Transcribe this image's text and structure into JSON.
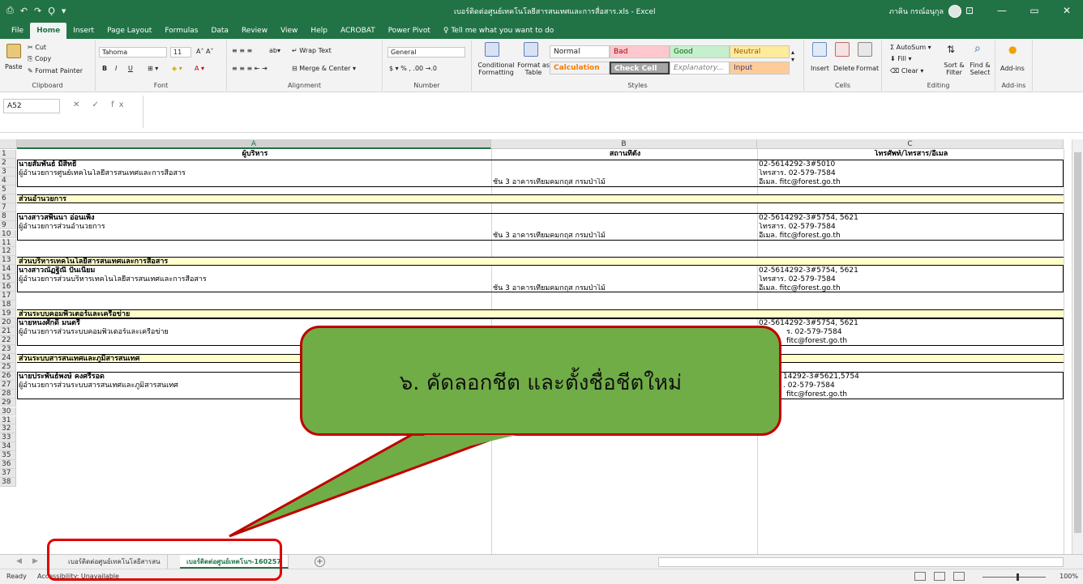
{
  "window": {
    "title": "เบอร์ติดต่อศูนย์เทคโนโลยีสารสนเทศและการสื่อสาร.xls  -  Excel",
    "user": "ภาคิน กรณ์อนุกุล",
    "qat": [
      "⎙",
      "↶",
      "↷",
      "Ǫ",
      "▾"
    ],
    "controls": [
      "⊡",
      "—",
      "▭",
      "✕"
    ]
  },
  "ribbon_tabs": [
    "File",
    "Home",
    "Insert",
    "Page Layout",
    "Formulas",
    "Data",
    "Review",
    "View",
    "Help",
    "ACROBAT",
    "Power Pivot"
  ],
  "tell_me": "Tell me what you want to do",
  "ribbon": {
    "clipboard": {
      "label": "Clipboard",
      "paste": "Paste",
      "cut": "Cut",
      "copy": "Copy",
      "format_painter": "Format Painter"
    },
    "font": {
      "label": "Font",
      "name": "Tahoma",
      "size": "11",
      "bold": "B",
      "italic": "I",
      "underline": "U"
    },
    "alignment": {
      "label": "Alignment",
      "wrap": "Wrap Text",
      "merge": "Merge & Center"
    },
    "number": {
      "label": "Number",
      "format": "General"
    },
    "styles": {
      "label": "Styles",
      "cond": "Conditional Formatting",
      "table": "Format as Table",
      "normal": "Normal",
      "bad": "Bad",
      "good": "Good",
      "neutral": "Neutral",
      "calculation": "Calculation",
      "check_cell": "Check Cell",
      "explanatory": "Explanatory...",
      "input": "Input"
    },
    "cells": {
      "label": "Cells",
      "insert": "Insert",
      "delete": "Delete",
      "format": "Format"
    },
    "editing": {
      "label": "Editing",
      "autosum": "AutoSum",
      "fill": "Fill",
      "clear": "Clear",
      "sort": "Sort & Filter",
      "find": "Find & Select"
    },
    "addins": {
      "label": "Add-ins",
      "btn": "Add-ins"
    }
  },
  "formula_bar": {
    "name_box": "A52",
    "fx": "✕  ✓  fx",
    "value": ""
  },
  "columns": [
    "A",
    "B",
    "C"
  ],
  "rows": [
    "1",
    "2",
    "3",
    "4",
    "5",
    "6",
    "7",
    "8",
    "9",
    "10",
    "11",
    "12",
    "13",
    "14",
    "15",
    "16",
    "17",
    "18",
    "19",
    "20",
    "21",
    "22",
    "23",
    "24",
    "25",
    "26",
    "27",
    "28",
    "29",
    "30",
    "31",
    "32",
    "33",
    "34",
    "35",
    "36",
    "37",
    "38"
  ],
  "sheet": {
    "headers": {
      "a": "ผู้บริหาร",
      "b": "สถานที่ตั้ง",
      "c": "โทรศัพท์/โทรสาร/อีเมล"
    },
    "r2a": "นายสัมพันธ์ มีสิทธิ์",
    "r3a": "ผู้อำนวยการศูนย์เทคโนโลยีสารสนเทศและการสื่อสาร",
    "r2c": "02-5614292-3#5010",
    "r3c": "โทรสาร. 02-579-7584",
    "r4c": "อีเมล. fitc@forest.go.th",
    "r4b": "ชั้น 3 อาคารเทียมคมกฤส กรมป่าไม้",
    "r6": "ส่วนอำนวยการ",
    "r7a": "นางสาวสพินนา อ่อนเพ็ง",
    "r8a": "ผู้อำนวยการส่วนอำนวยการ",
    "r7c": "02-5614292-3#5754, 5621",
    "r8c": "โทรสาร. 02-579-7584",
    "r9c": "อีเมล. fitc@forest.go.th",
    "r9b": "ชั้น 3 อาคารเทียมคมกฤส กรมป่าไม้",
    "r11": "ส่วนบริหารเทคโนโลยีสารสนเทศและการสื่อสาร",
    "r12a": "นางสาวณัฏฐิณี ปั้นเนียม",
    "r13a": "ผู้อำนวยการส่วนบริหารเทคโนโลยีสารสนเทศและการสื่อสาร",
    "r12c": "02-5614292-3#5754, 5621",
    "r13c": "โทรสาร. 02-579-7584",
    "r14c": "อีเมล. fitc@forest.go.th",
    "r14b": "ชั้น 3 อาคารเทียมคมกฤส กรมป่าไม้",
    "r16": "ส่วนระบบคอมพิวเตอร์และเครือข่าย",
    "r17a": "นายหนงศักดิ์ มนตรี",
    "r18a": "ผู้อำนวยการส่วนระบบคอมพิวเตอร์และเครือข่าย",
    "r17c": "02-5614292-3#5754, 5621",
    "r18c": "ร. 02-579-7584",
    "r19c": "fitc@forest.go.th",
    "r21": "ส่วนระบบสารสนเทศและภูมิสารสนเทศ",
    "r22a": "นายประพันธ์พงษ์ คงศรีรอด",
    "r23a": "ผู้อำนวยการส่วนระบบสารสนเทศและภูมิสารสนเทศ",
    "r22c": "14292-3#5621,5754",
    "r23c": ". 02-579-7584",
    "r24c": "fitc@forest.go.th"
  },
  "sheet_tabs": [
    "เบอร์ติดต่อศูนย์เทคโนโลยีสารสน",
    "เบอร์ติดต่อศูนย์เทคโนฯ-160257"
  ],
  "status": {
    "ready": "Ready",
    "accessibility": "Accessibility: Unavailable",
    "zoom": "100%"
  },
  "callout": {
    "text": "๖. คัดลอกชีต และตั้งชื่อชีตใหม่"
  },
  "colors": {
    "excel_green": "#217346",
    "callout_fill": "#70ad47",
    "callout_border": "#c00000",
    "highlight_red": "#e00000",
    "section_fill": "#ffffcc"
  }
}
